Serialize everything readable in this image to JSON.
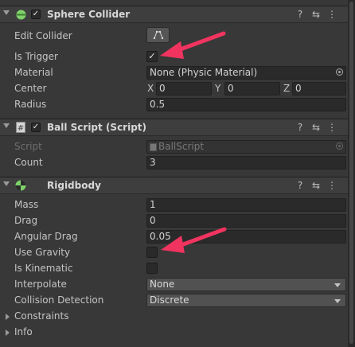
{
  "components": {
    "sphere_collider": {
      "title": "Sphere Collider",
      "enabled_mark": "✓",
      "edit_collider_label": "Edit Collider",
      "is_trigger_label": "Is Trigger",
      "is_trigger_mark": "✓",
      "material_label": "Material",
      "material_value": "None (Physic Material)",
      "center_label": "Center",
      "center": {
        "x_label": "X",
        "x": "0",
        "y_label": "Y",
        "y": "0",
        "z_label": "Z",
        "z": "0"
      },
      "radius_label": "Radius",
      "radius_value": "0.5"
    },
    "ball_script": {
      "title": "Ball Script (Script)",
      "enabled_mark": "✓",
      "script_label": "Script",
      "script_value": "BallScript",
      "count_label": "Count",
      "count_value": "3"
    },
    "rigidbody": {
      "title": "Rigidbody",
      "mass_label": "Mass",
      "mass_value": "1",
      "drag_label": "Drag",
      "drag_value": "0",
      "angular_drag_label": "Angular Drag",
      "angular_drag_value": "0.05",
      "use_gravity_label": "Use Gravity",
      "is_kinematic_label": "Is Kinematic",
      "interpolate_label": "Interpolate",
      "interpolate_value": "None",
      "collision_detection_label": "Collision Detection",
      "collision_detection_value": "Discrete",
      "constraints_label": "Constraints",
      "info_label": "Info"
    }
  },
  "header_icons": [
    "help-icon",
    "settings-sliders-icon",
    "more-vertical-icon"
  ],
  "header_glyphs": {
    "help": "?",
    "settings": "⇆",
    "more": "⋮"
  },
  "annotation_color": "#f0345f"
}
